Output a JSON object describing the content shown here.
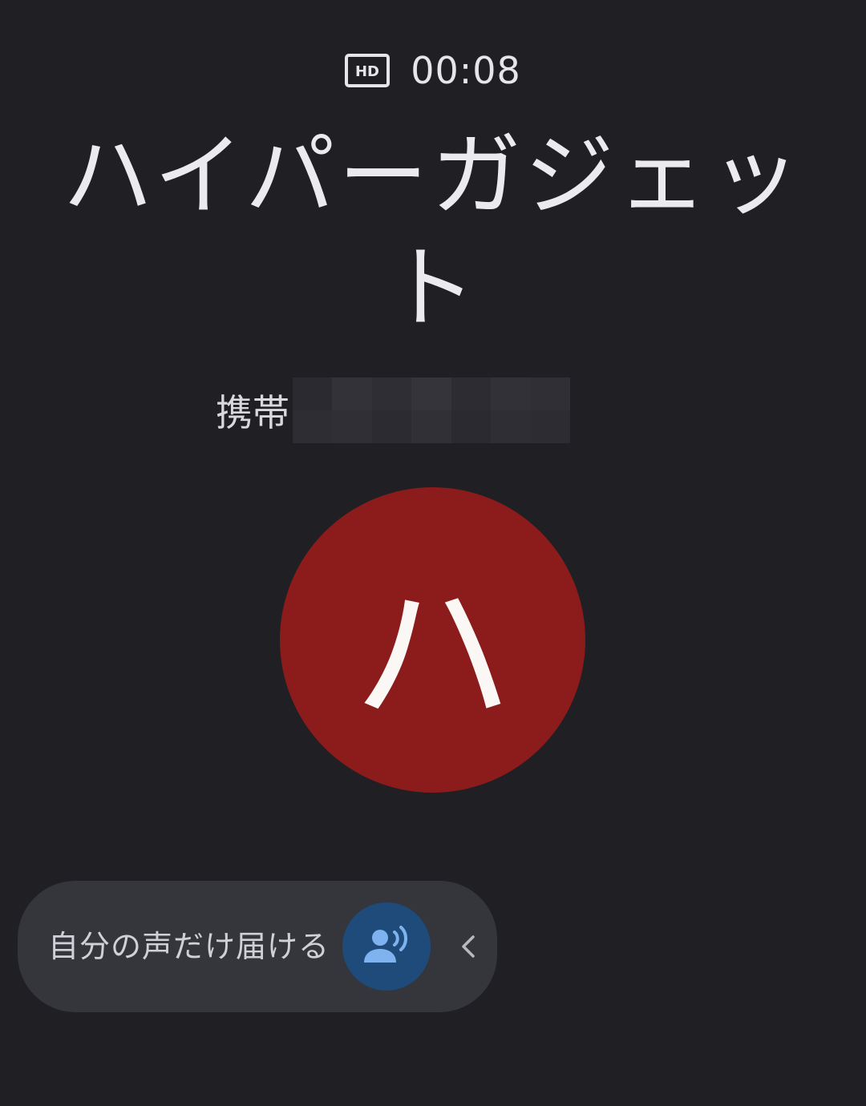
{
  "call": {
    "hd_icon": "hd-icon",
    "timer": "00:08",
    "contact_name": "ハイパーガジェット",
    "number_label": "携帯",
    "avatar_initial": "ハ"
  },
  "voice_isolation": {
    "label": "自分の声だけ届ける",
    "icon": "voice-selection-icon",
    "collapse_icon": "chevron-left-icon",
    "accent": "#1e4b7a",
    "icon_color": "#7fb3f0"
  },
  "colors": {
    "background": "#1f1f24",
    "avatar": "#8b1c1b",
    "pill": "#34363c"
  }
}
